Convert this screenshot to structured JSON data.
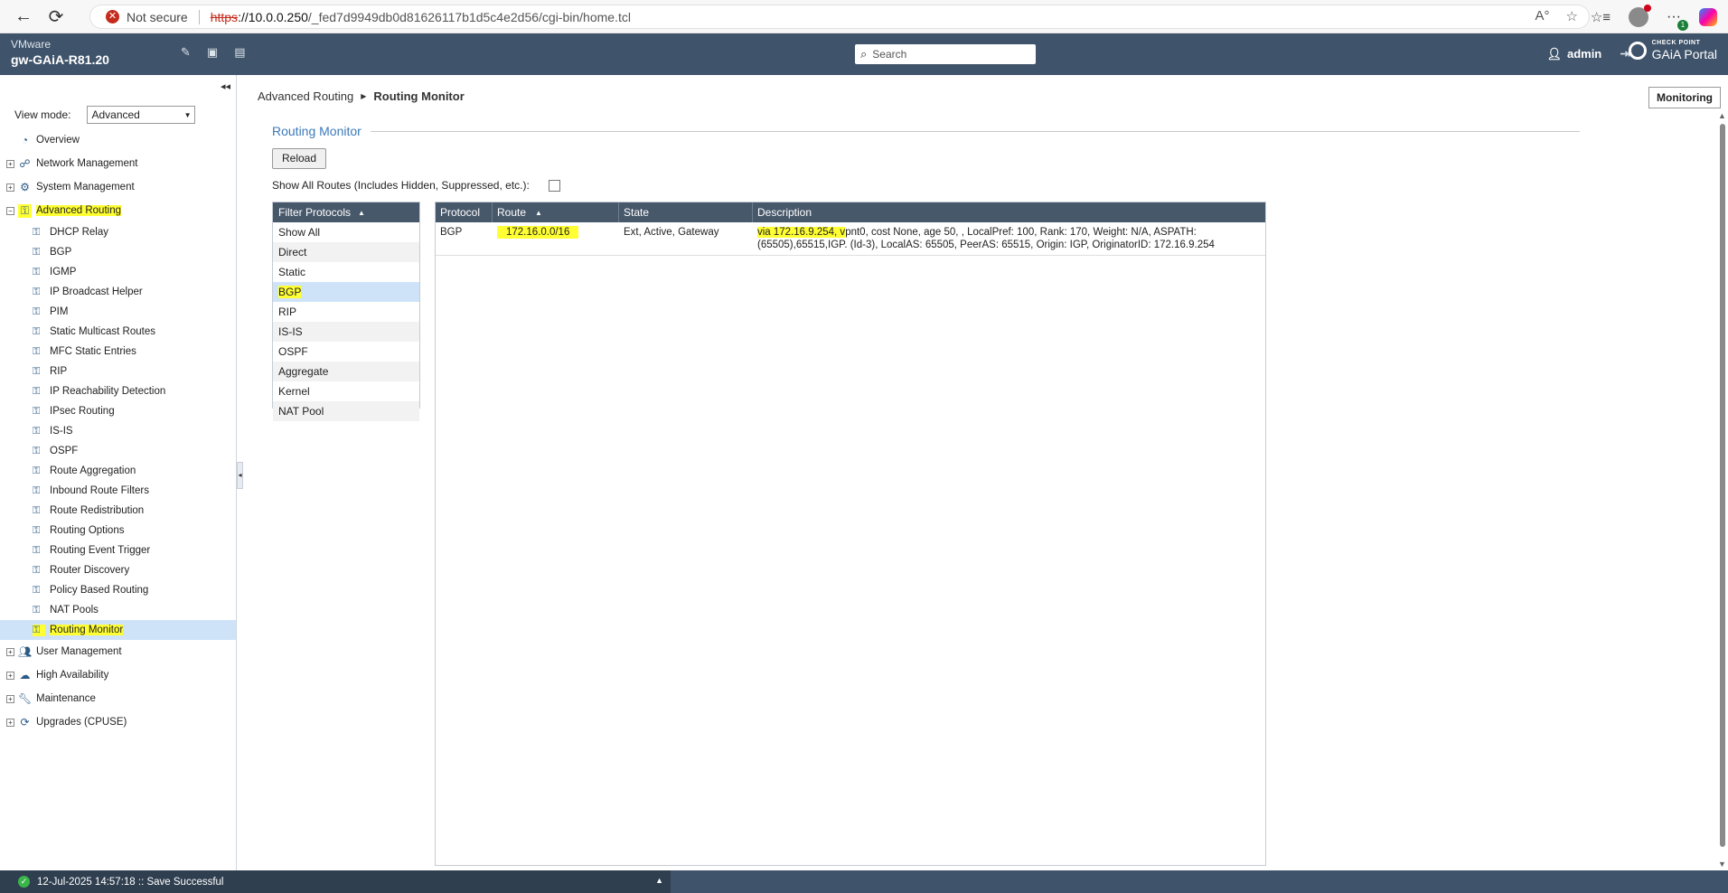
{
  "browser": {
    "back": "←",
    "refresh": "⟳",
    "security_text": "Not secure",
    "url_scheme": "https",
    "url_host": "://10.0.0.250",
    "url_path": "/_fed7d9949db0d81626117b1d5c4e2d56/cgi-bin/home.tcl",
    "dots_badge": "1"
  },
  "header": {
    "platform": "VMware",
    "gateway_name": "gw-GAiA-R81.20",
    "search_placeholder": "Search",
    "user": "admin",
    "brand_top": "CHECK POINT",
    "brand_bottom": "GAiA Portal"
  },
  "sidebar": {
    "view_mode_label": "View mode:",
    "view_mode_value": "Advanced",
    "top_items": [
      {
        "label": "Overview"
      },
      {
        "label": "Network Management"
      },
      {
        "label": "System Management"
      },
      {
        "label": "Advanced Routing"
      }
    ],
    "routing_children": [
      "DHCP Relay",
      "BGP",
      "IGMP",
      "IP Broadcast Helper",
      "PIM",
      "Static Multicast Routes",
      "MFC Static Entries",
      "RIP",
      "IP Reachability Detection",
      "IPsec Routing",
      "IS-IS",
      "OSPF",
      "Route Aggregation",
      "Inbound Route Filters",
      "Route Redistribution",
      "Routing Options",
      "Routing Event Trigger",
      "Router Discovery",
      "Policy Based Routing",
      "NAT Pools",
      "Routing Monitor"
    ],
    "bottom_items": [
      {
        "label": "User Management"
      },
      {
        "label": "High Availability"
      },
      {
        "label": "Maintenance"
      },
      {
        "label": "Upgrades (CPUSE)"
      }
    ]
  },
  "main": {
    "breadcrumb_parent": "Advanced Routing",
    "breadcrumb_current": "Routing Monitor",
    "monitoring_button": "Monitoring",
    "section_title": "Routing Monitor",
    "reload_button": "Reload",
    "show_all_label": "Show All Routes (Includes Hidden, Suppressed, etc.):",
    "filter_header": "Filter Protocols",
    "filter_items": [
      "Show All",
      "Direct",
      "Static",
      "BGP",
      "RIP",
      "IS-IS",
      "OSPF",
      "Aggregate",
      "Kernel",
      "NAT Pool"
    ],
    "table_headers": {
      "protocol": "Protocol",
      "route": "Route",
      "state": "State",
      "description": "Description"
    },
    "rows": [
      {
        "protocol": "BGP",
        "route": "172.16.0.0/16",
        "state": "Ext, Active, Gateway",
        "desc_highlight": "via 172.16.9.254, v",
        "desc_rest": "pnt0, cost None, age 50, , LocalPref: 100, Rank: 170, Weight: N/A, ASPATH: (65505),65515,IGP. (Id-3), LocalAS: 65505, PeerAS: 65515, Origin: IGP, OriginatorID: 172.16.9.254"
      }
    ]
  },
  "status": {
    "message": "12-Jul-2025 14:57:18 :: Save Successful"
  }
}
